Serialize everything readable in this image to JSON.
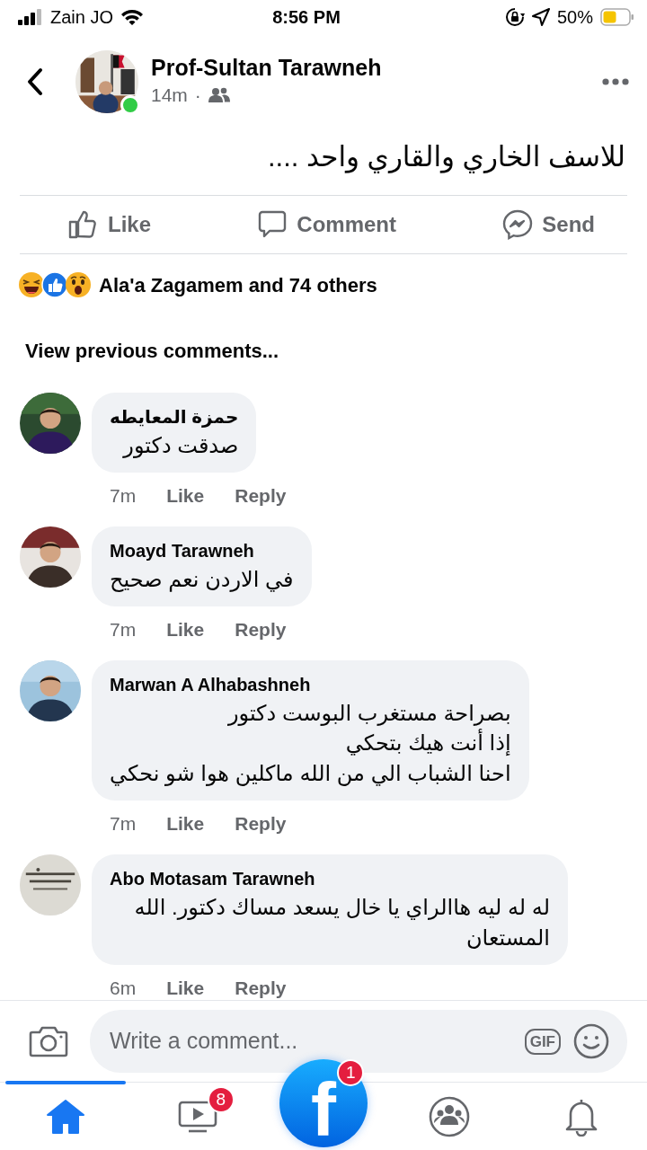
{
  "status_bar": {
    "carrier": "Zain JO",
    "time": "8:56 PM",
    "battery": "50%"
  },
  "post": {
    "author": "Prof-Sultan Tarawneh",
    "online": true,
    "time": "14m",
    "separator": "·",
    "text": "للاسف الخاري والقاري واحد ....",
    "actions": [
      {
        "kind": "like",
        "label": "Like"
      },
      {
        "kind": "comment",
        "label": "Comment"
      },
      {
        "kind": "send",
        "label": "Send"
      }
    ],
    "reactions": {
      "icons": [
        {
          "kind": "haha"
        },
        {
          "kind": "like"
        },
        {
          "kind": "wow"
        }
      ],
      "summary": "Ala'a Zagamem and 74 others"
    }
  },
  "view_previous": "View previous comments...",
  "comments": [
    {
      "author": "حمزة المعايطه",
      "text": "صدقت دكتور",
      "time": "7m",
      "like": "Like",
      "reply": "Reply"
    },
    {
      "author": "Moayd Tarawneh",
      "text": "في الاردن نعم صحيح",
      "time": "7m",
      "like": "Like",
      "reply": "Reply"
    },
    {
      "author": "Marwan A Alhabashneh",
      "text": "بصراحة مستغرب البوست دكتور\nإذا أنت هيك بتحكي\nاحنا الشباب الي من الله ماكلين هوا شو نحكي",
      "time": "7m",
      "like": "Like",
      "reply": "Reply"
    },
    {
      "author": "Abo Motasam Tarawneh",
      "text": "له له ليه هاالراي يا خال يسعد مساك دكتور. الله المستعان",
      "time": "6m",
      "like": "Like",
      "reply": "Reply"
    }
  ],
  "composer": {
    "placeholder": "Write a comment...",
    "gif": "GIF"
  },
  "bottom_nav": [
    {
      "kind": "home",
      "selected": true
    },
    {
      "kind": "video",
      "selected": false,
      "badge": "8"
    },
    {
      "kind": "logo",
      "selected": false,
      "badge": "1",
      "letter": "f"
    },
    {
      "kind": "groups",
      "selected": false
    },
    {
      "kind": "bell",
      "selected": false
    }
  ]
}
